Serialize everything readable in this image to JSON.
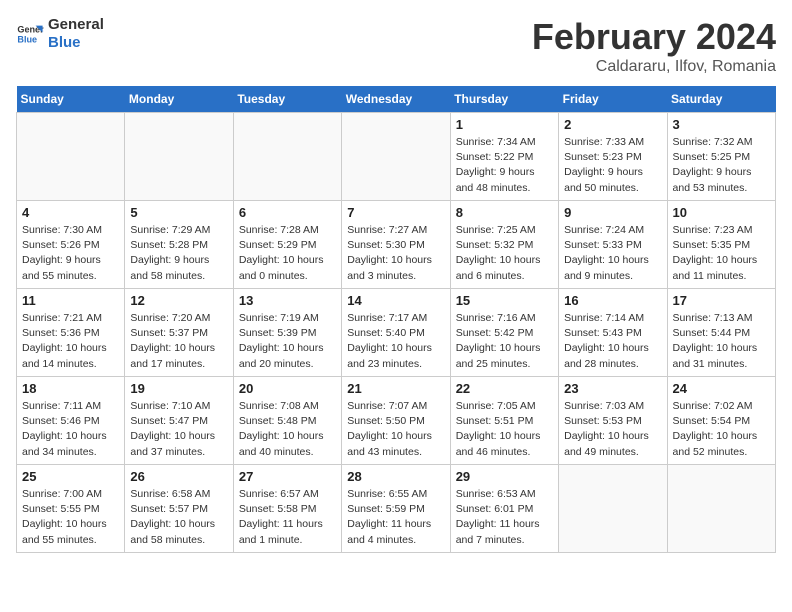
{
  "header": {
    "logo_general": "General",
    "logo_blue": "Blue",
    "title": "February 2024",
    "subtitle": "Caldararu, Ilfov, Romania"
  },
  "weekdays": [
    "Sunday",
    "Monday",
    "Tuesday",
    "Wednesday",
    "Thursday",
    "Friday",
    "Saturday"
  ],
  "weeks": [
    [
      {
        "day": "",
        "info": ""
      },
      {
        "day": "",
        "info": ""
      },
      {
        "day": "",
        "info": ""
      },
      {
        "day": "",
        "info": ""
      },
      {
        "day": "1",
        "info": "Sunrise: 7:34 AM\nSunset: 5:22 PM\nDaylight: 9 hours\nand 48 minutes."
      },
      {
        "day": "2",
        "info": "Sunrise: 7:33 AM\nSunset: 5:23 PM\nDaylight: 9 hours\nand 50 minutes."
      },
      {
        "day": "3",
        "info": "Sunrise: 7:32 AM\nSunset: 5:25 PM\nDaylight: 9 hours\nand 53 minutes."
      }
    ],
    [
      {
        "day": "4",
        "info": "Sunrise: 7:30 AM\nSunset: 5:26 PM\nDaylight: 9 hours\nand 55 minutes."
      },
      {
        "day": "5",
        "info": "Sunrise: 7:29 AM\nSunset: 5:28 PM\nDaylight: 9 hours\nand 58 minutes."
      },
      {
        "day": "6",
        "info": "Sunrise: 7:28 AM\nSunset: 5:29 PM\nDaylight: 10 hours\nand 0 minutes."
      },
      {
        "day": "7",
        "info": "Sunrise: 7:27 AM\nSunset: 5:30 PM\nDaylight: 10 hours\nand 3 minutes."
      },
      {
        "day": "8",
        "info": "Sunrise: 7:25 AM\nSunset: 5:32 PM\nDaylight: 10 hours\nand 6 minutes."
      },
      {
        "day": "9",
        "info": "Sunrise: 7:24 AM\nSunset: 5:33 PM\nDaylight: 10 hours\nand 9 minutes."
      },
      {
        "day": "10",
        "info": "Sunrise: 7:23 AM\nSunset: 5:35 PM\nDaylight: 10 hours\nand 11 minutes."
      }
    ],
    [
      {
        "day": "11",
        "info": "Sunrise: 7:21 AM\nSunset: 5:36 PM\nDaylight: 10 hours\nand 14 minutes."
      },
      {
        "day": "12",
        "info": "Sunrise: 7:20 AM\nSunset: 5:37 PM\nDaylight: 10 hours\nand 17 minutes."
      },
      {
        "day": "13",
        "info": "Sunrise: 7:19 AM\nSunset: 5:39 PM\nDaylight: 10 hours\nand 20 minutes."
      },
      {
        "day": "14",
        "info": "Sunrise: 7:17 AM\nSunset: 5:40 PM\nDaylight: 10 hours\nand 23 minutes."
      },
      {
        "day": "15",
        "info": "Sunrise: 7:16 AM\nSunset: 5:42 PM\nDaylight: 10 hours\nand 25 minutes."
      },
      {
        "day": "16",
        "info": "Sunrise: 7:14 AM\nSunset: 5:43 PM\nDaylight: 10 hours\nand 28 minutes."
      },
      {
        "day": "17",
        "info": "Sunrise: 7:13 AM\nSunset: 5:44 PM\nDaylight: 10 hours\nand 31 minutes."
      }
    ],
    [
      {
        "day": "18",
        "info": "Sunrise: 7:11 AM\nSunset: 5:46 PM\nDaylight: 10 hours\nand 34 minutes."
      },
      {
        "day": "19",
        "info": "Sunrise: 7:10 AM\nSunset: 5:47 PM\nDaylight: 10 hours\nand 37 minutes."
      },
      {
        "day": "20",
        "info": "Sunrise: 7:08 AM\nSunset: 5:48 PM\nDaylight: 10 hours\nand 40 minutes."
      },
      {
        "day": "21",
        "info": "Sunrise: 7:07 AM\nSunset: 5:50 PM\nDaylight: 10 hours\nand 43 minutes."
      },
      {
        "day": "22",
        "info": "Sunrise: 7:05 AM\nSunset: 5:51 PM\nDaylight: 10 hours\nand 46 minutes."
      },
      {
        "day": "23",
        "info": "Sunrise: 7:03 AM\nSunset: 5:53 PM\nDaylight: 10 hours\nand 49 minutes."
      },
      {
        "day": "24",
        "info": "Sunrise: 7:02 AM\nSunset: 5:54 PM\nDaylight: 10 hours\nand 52 minutes."
      }
    ],
    [
      {
        "day": "25",
        "info": "Sunrise: 7:00 AM\nSunset: 5:55 PM\nDaylight: 10 hours\nand 55 minutes."
      },
      {
        "day": "26",
        "info": "Sunrise: 6:58 AM\nSunset: 5:57 PM\nDaylight: 10 hours\nand 58 minutes."
      },
      {
        "day": "27",
        "info": "Sunrise: 6:57 AM\nSunset: 5:58 PM\nDaylight: 11 hours\nand 1 minute."
      },
      {
        "day": "28",
        "info": "Sunrise: 6:55 AM\nSunset: 5:59 PM\nDaylight: 11 hours\nand 4 minutes."
      },
      {
        "day": "29",
        "info": "Sunrise: 6:53 AM\nSunset: 6:01 PM\nDaylight: 11 hours\nand 7 minutes."
      },
      {
        "day": "",
        "info": ""
      },
      {
        "day": "",
        "info": ""
      }
    ]
  ]
}
